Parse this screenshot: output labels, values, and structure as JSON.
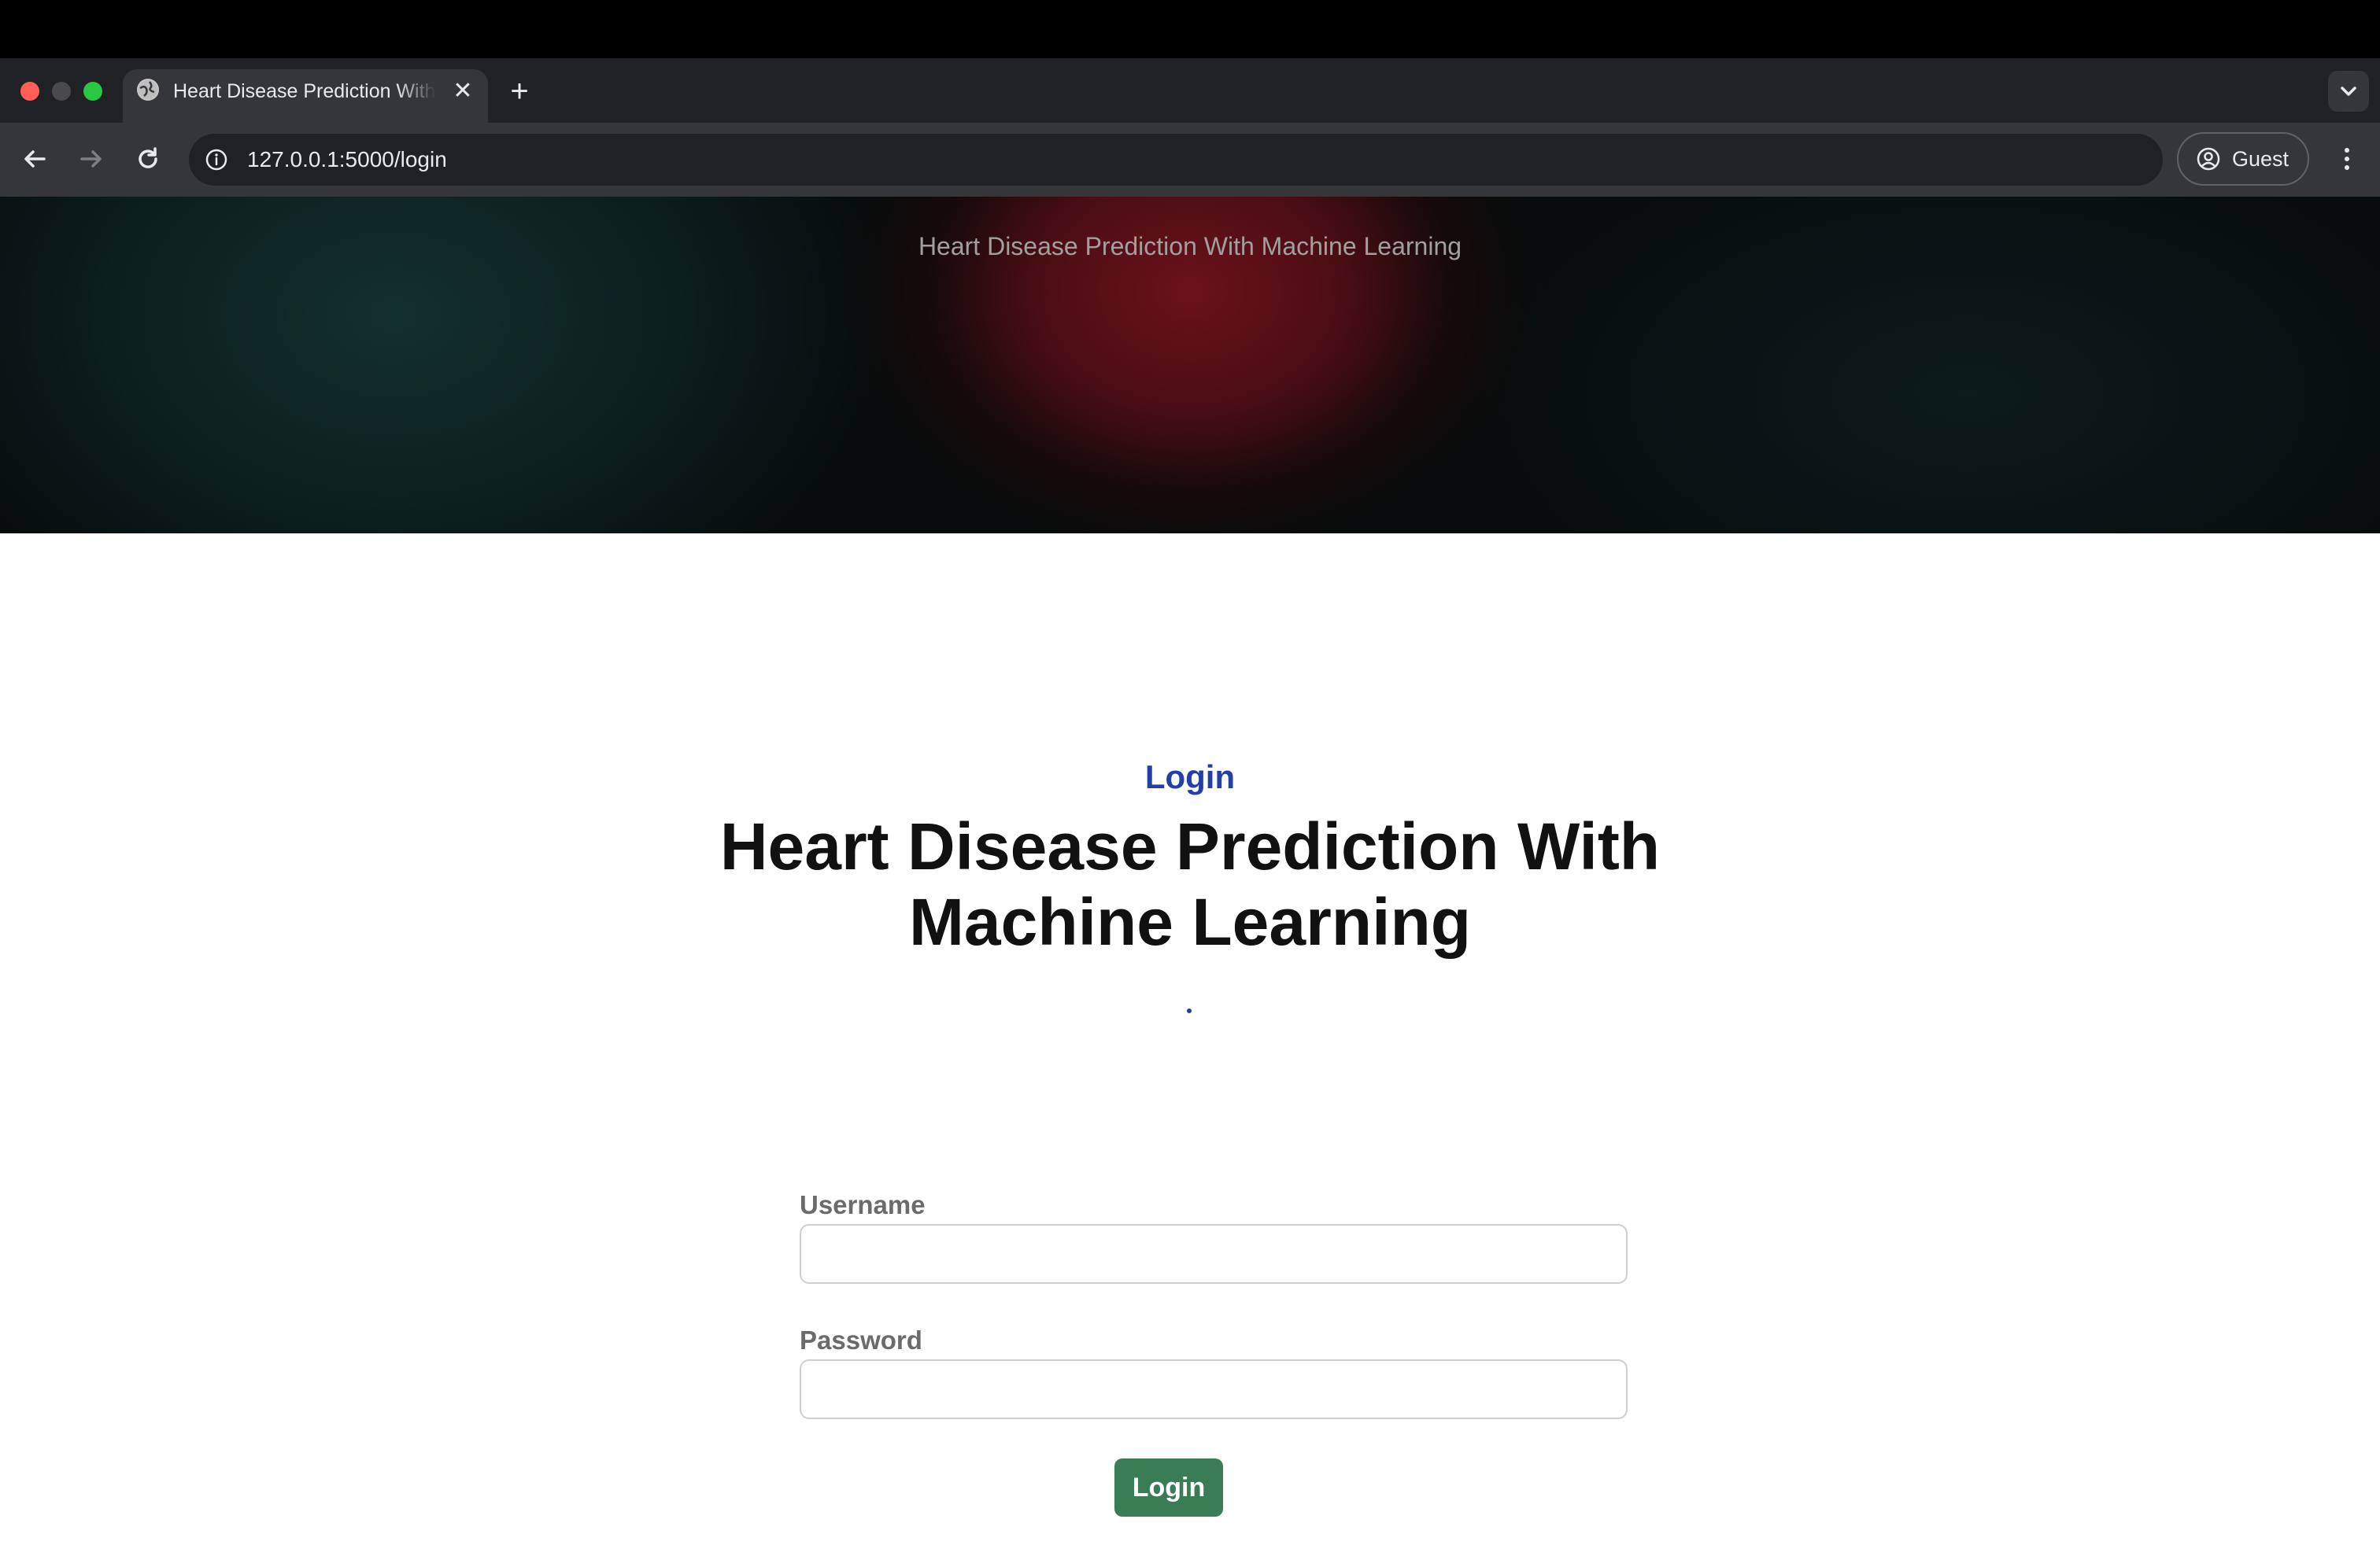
{
  "browser": {
    "tab": {
      "title": "Heart Disease Prediction With Machine Learning",
      "favicon": "globe-icon"
    },
    "new_tab_symbol": "+",
    "close_symbol": "✕",
    "address_bar": {
      "url": "127.0.0.1:5000/login"
    },
    "profile": {
      "label": "Guest"
    }
  },
  "hero": {
    "title": "Heart Disease Prediction With Machine Learning"
  },
  "main": {
    "section_label": "Login",
    "heading": "Heart Disease Prediction With Machine Learning"
  },
  "form": {
    "username_label": "Username",
    "username_value": "",
    "password_label": "Password",
    "password_value": "",
    "submit_label": "Login"
  },
  "colors": {
    "accent_blue": "#2240a8",
    "button_green": "#3a7d55",
    "chrome_dark": "#35363a"
  }
}
